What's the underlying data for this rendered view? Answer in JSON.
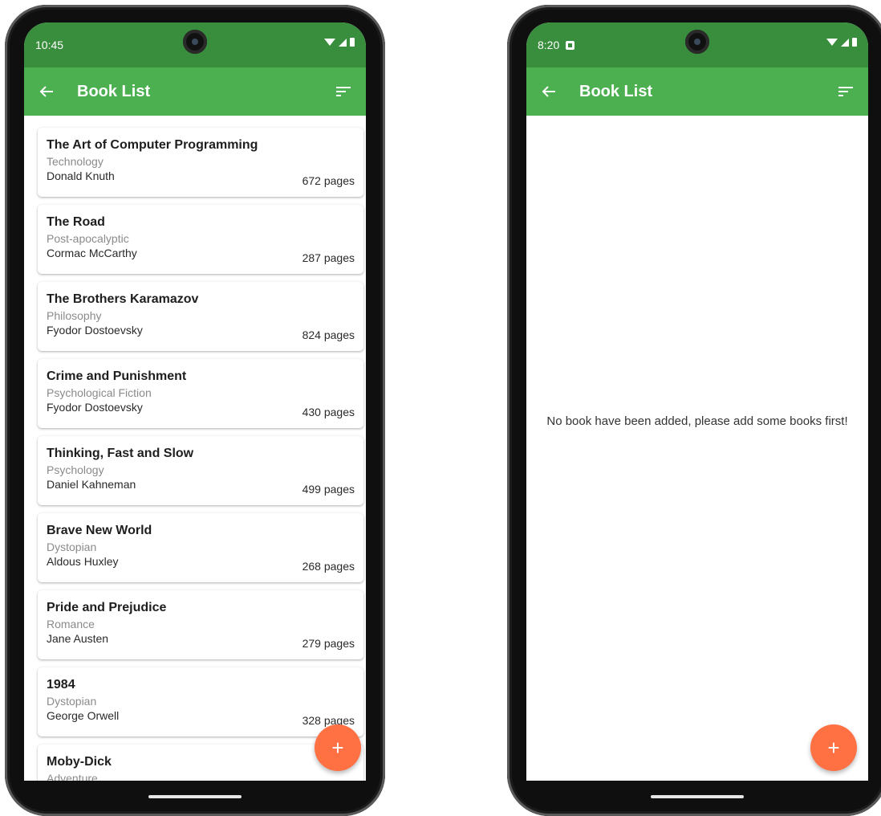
{
  "left_screen": {
    "status": {
      "time": "10:45"
    },
    "app_bar": {
      "title": "Book List",
      "back_icon": "arrow-left-icon",
      "sort_icon": "sort-icon"
    },
    "books": [
      {
        "title": "The Art of Computer Programming",
        "genre": "Technology",
        "author": "Donald Knuth",
        "pages": "672 pages"
      },
      {
        "title": "The Road",
        "genre": "Post-apocalyptic",
        "author": "Cormac McCarthy",
        "pages": "287 pages"
      },
      {
        "title": "The Brothers Karamazov",
        "genre": "Philosophy",
        "author": "Fyodor Dostoevsky",
        "pages": "824 pages"
      },
      {
        "title": "Crime and Punishment",
        "genre": "Psychological Fiction",
        "author": "Fyodor Dostoevsky",
        "pages": "430 pages"
      },
      {
        "title": "Thinking, Fast and Slow",
        "genre": "Psychology",
        "author": "Daniel Kahneman",
        "pages": "499 pages"
      },
      {
        "title": "Brave New World",
        "genre": "Dystopian",
        "author": "Aldous Huxley",
        "pages": "268 pages"
      },
      {
        "title": "Pride and Prejudice",
        "genre": "Romance",
        "author": "Jane Austen",
        "pages": "279 pages"
      },
      {
        "title": "1984",
        "genre": "Dystopian",
        "author": "George Orwell",
        "pages": "328 pages"
      },
      {
        "title": "Moby-Dick",
        "genre": "Adventure",
        "author": "",
        "pages": ""
      }
    ],
    "fab": {
      "label": "+",
      "icon": "plus-icon"
    }
  },
  "right_screen": {
    "status": {
      "time": "8:20"
    },
    "app_bar": {
      "title": "Book List",
      "back_icon": "arrow-left-icon",
      "sort_icon": "sort-icon"
    },
    "empty_message": "No book have been added, please add some books first!",
    "fab": {
      "label": "+",
      "icon": "plus-icon"
    }
  },
  "colors": {
    "status_bar": "#388e3c",
    "app_bar": "#4caf50",
    "fab": "#ff7043"
  }
}
